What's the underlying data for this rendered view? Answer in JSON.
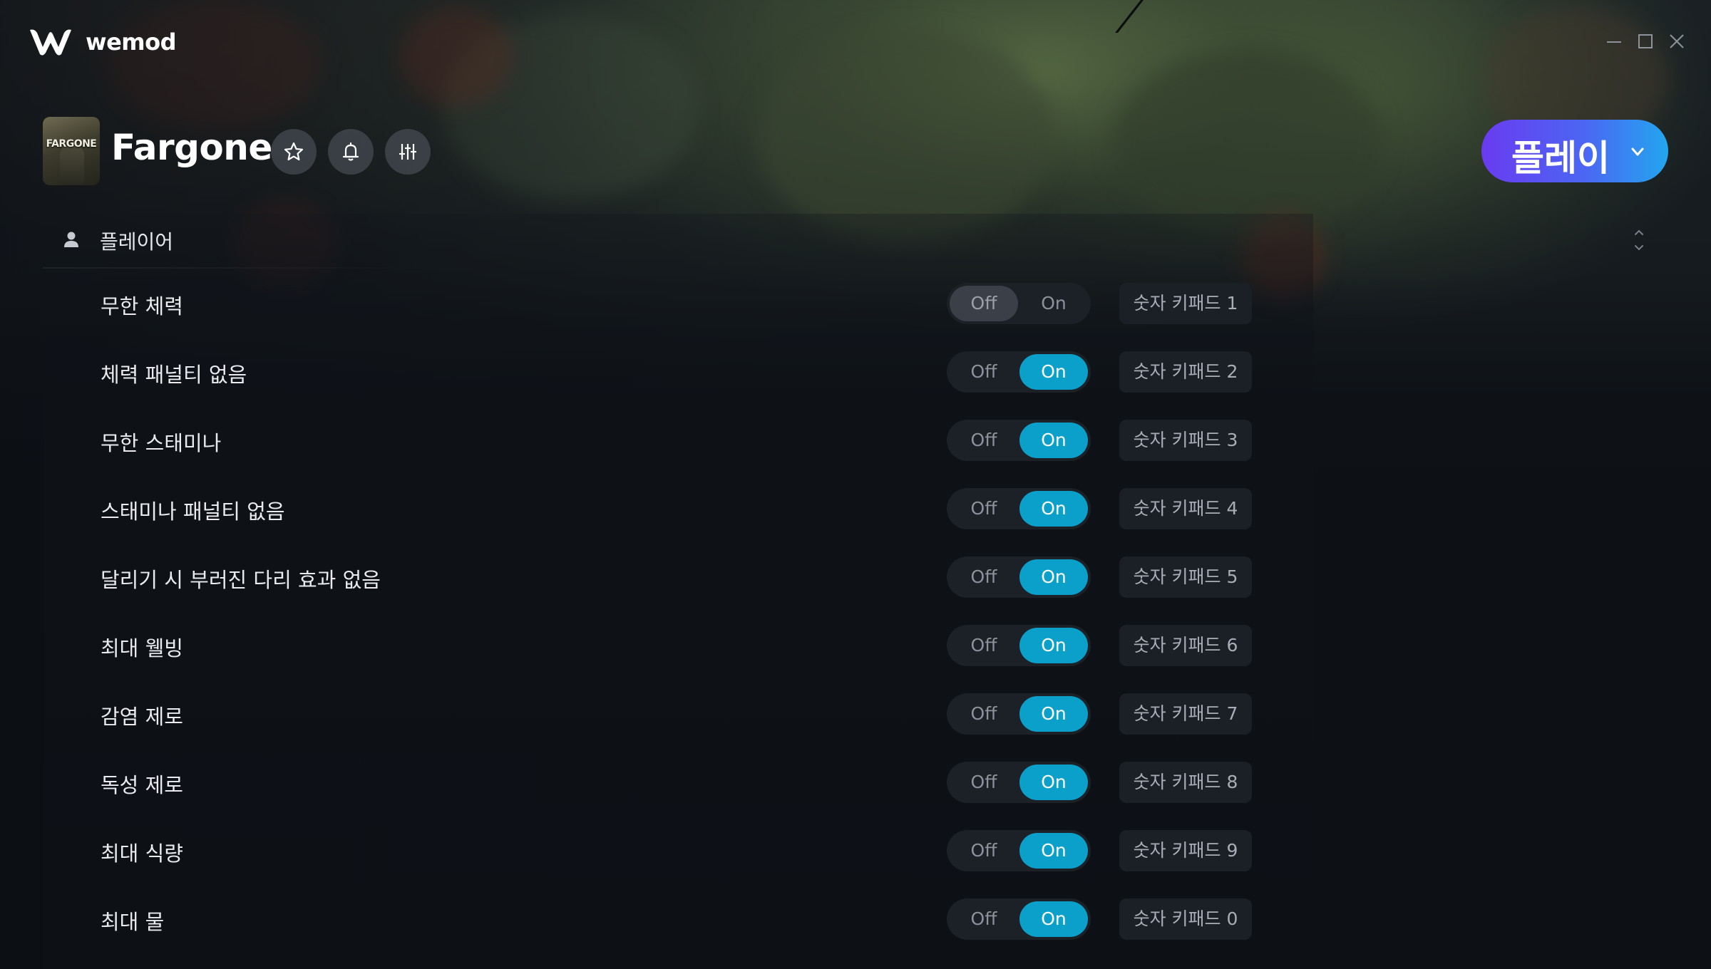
{
  "app": {
    "brand": "wemod"
  },
  "window_controls": [
    "minimize-icon",
    "maximize-icon",
    "close-icon"
  ],
  "game": {
    "title": "Fargone",
    "cover_text": "FARGONE",
    "header_buttons": [
      "star-icon",
      "bell-icon",
      "sliders-icon"
    ],
    "play_label": "플레이"
  },
  "category": {
    "label": "플레이어",
    "icon": "person-icon"
  },
  "cheats": [
    {
      "name": "무한 체력",
      "off": "Off",
      "on": "On",
      "state": "off",
      "hotkey": "숫자 키패드 1"
    },
    {
      "name": "체력 패널티 없음",
      "off": "Off",
      "on": "On",
      "state": "on",
      "hotkey": "숫자 키패드 2"
    },
    {
      "name": "무한 스태미나",
      "off": "Off",
      "on": "On",
      "state": "on",
      "hotkey": "숫자 키패드 3"
    },
    {
      "name": "스태미나 패널티 없음",
      "off": "Off",
      "on": "On",
      "state": "on",
      "hotkey": "숫자 키패드 4"
    },
    {
      "name": "달리기 시 부러진 다리 효과 없음",
      "off": "Off",
      "on": "On",
      "state": "on",
      "hotkey": "숫자 키패드 5"
    },
    {
      "name": "최대 웰빙",
      "off": "Off",
      "on": "On",
      "state": "on",
      "hotkey": "숫자 키패드 6"
    },
    {
      "name": "감염 제로",
      "off": "Off",
      "on": "On",
      "state": "on",
      "hotkey": "숫자 키패드 7"
    },
    {
      "name": "독성 제로",
      "off": "Off",
      "on": "On",
      "state": "on",
      "hotkey": "숫자 키패드 8"
    },
    {
      "name": "최대 식량",
      "off": "Off",
      "on": "On",
      "state": "on",
      "hotkey": "숫자 키패드 9"
    },
    {
      "name": "최대 물",
      "off": "Off",
      "on": "On",
      "state": "on",
      "hotkey": "숫자 키패드 0"
    }
  ],
  "colors": {
    "toggle_on": "#0aa0c9",
    "play_gradient_start": "#6a3bf0",
    "play_gradient_end": "#23a6ef",
    "background": "#0d1116"
  }
}
